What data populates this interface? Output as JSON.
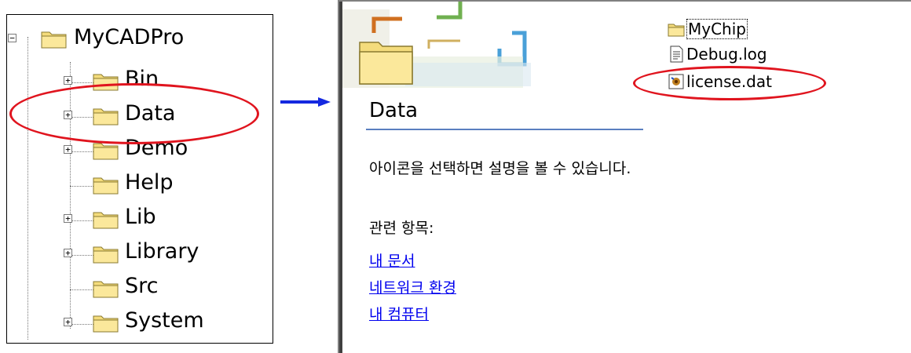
{
  "tree": {
    "root": {
      "label": "MyCADPro",
      "expander": "−"
    },
    "items": [
      {
        "label": "Bin",
        "expander": "+"
      },
      {
        "label": "Data",
        "expander": "+"
      },
      {
        "label": "Demo",
        "expander": "+"
      },
      {
        "label": "Help",
        "expander": ""
      },
      {
        "label": "Lib",
        "expander": "+"
      },
      {
        "label": "Library",
        "expander": "+"
      },
      {
        "label": "Src",
        "expander": ""
      },
      {
        "label": "System",
        "expander": "+"
      }
    ]
  },
  "explorer": {
    "folder_title": "Data",
    "description": "아이콘을 선택하면 설명을 볼 수 있습니다.",
    "related_heading": "관련 항목:",
    "related_links": [
      "내 문서",
      "네트워크 환경",
      "내 컴퓨터"
    ],
    "files": [
      {
        "name": "MyChip",
        "icon": "folder-icon"
      },
      {
        "name": "Debug.log",
        "icon": "text-file-icon"
      },
      {
        "name": "license.dat",
        "icon": "dat-file-icon"
      }
    ]
  },
  "colors": {
    "highlight_ellipse": "#e0141e",
    "arrow": "#1428e0",
    "link": "#0000ee",
    "folder": "#f4dc7c"
  }
}
